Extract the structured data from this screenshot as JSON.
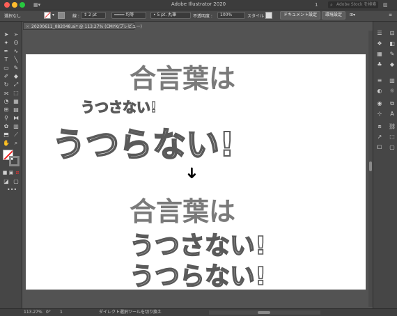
{
  "window": {
    "title": "Adobe Illustrator 2020"
  },
  "top_right": {
    "workspace": "1",
    "search_placeholder": "Adobe Stock を検索"
  },
  "control_bar": {
    "selection": "選択なし",
    "stroke_label": "線 :",
    "stroke_width": "2 pt",
    "uniform": "均等",
    "brush": "5 pt. 丸筆",
    "opacity_label": "不透明度 :",
    "opacity": "100%",
    "style_label": "スタイル :",
    "doc_settings": "ドキュメント設定",
    "prefs": "環境設定"
  },
  "document_tab": {
    "label": "20200611_082048.ai* @ 113.27% (CMYK/プレビュー)"
  },
  "artwork": {
    "top_heading": "合言葉は",
    "small_outline": "うつさない!",
    "large_outline": "うつらない!",
    "arrow": "➜",
    "bottom_heading": "合言葉は",
    "bottom_line1": "うつさない!",
    "bottom_line2": "うつらない!"
  },
  "status_bar": {
    "zoom": "113.27%",
    "rotation": "0°",
    "artboard": "1",
    "tool_hint": "ダイレクト選択ツールを切り換え"
  }
}
